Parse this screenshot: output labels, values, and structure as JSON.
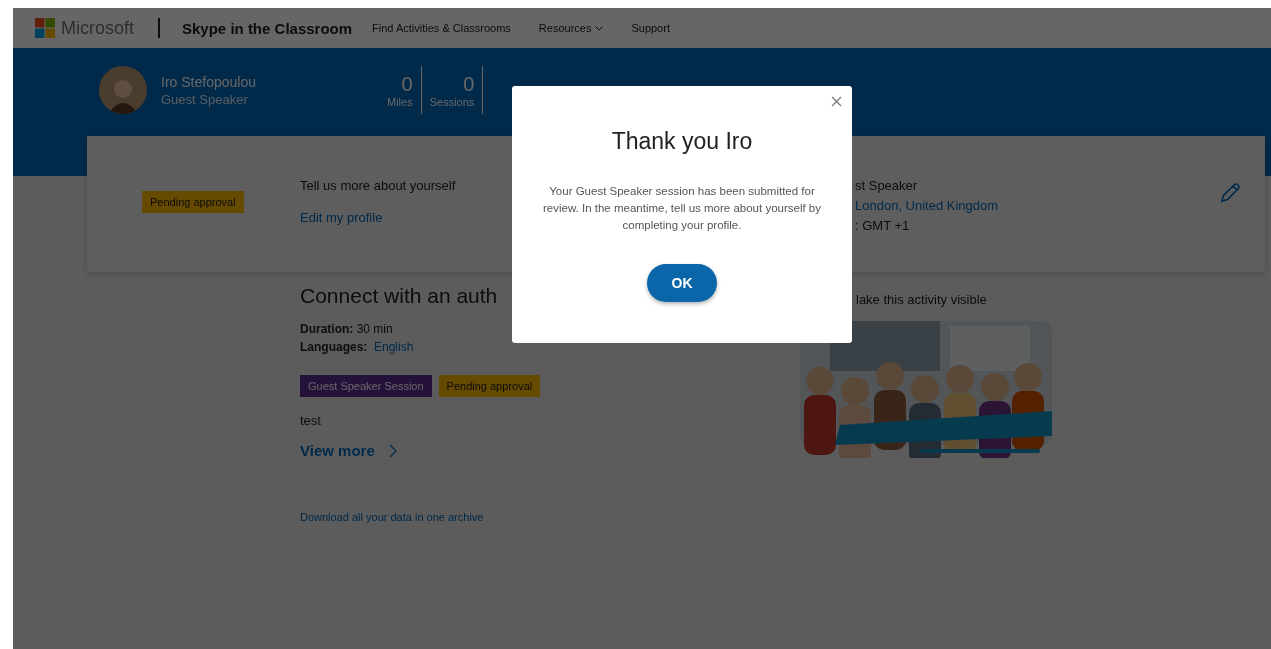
{
  "nav": {
    "brand": "Microsoft",
    "product": "Skype in the Classroom",
    "links": [
      {
        "label": "Find Activities & Classrooms",
        "dropdown": false
      },
      {
        "label": "Resources",
        "dropdown": true
      },
      {
        "label": "Support",
        "dropdown": false
      }
    ]
  },
  "profile": {
    "name": "Iro Stefopoulou",
    "role": "Guest Speaker",
    "stats": [
      {
        "value": "0",
        "label": "Miles"
      },
      {
        "value": "0",
        "label": "Sessions"
      }
    ]
  },
  "card": {
    "status": "Pending approval",
    "prompt": "Tell us more about yourself",
    "edit_link": "Edit my profile",
    "details": [
      {
        "kind": "plain",
        "text": "st Speaker"
      },
      {
        "kind": "link",
        "text": "London, United Kingdom"
      },
      {
        "kind": "plain",
        "text": ": GMT +1"
      }
    ]
  },
  "activity": {
    "title": "Connect with an auth",
    "duration_label": "Duration:",
    "duration": "30 min",
    "languages_label": "Languages:",
    "language": "English",
    "tags": [
      {
        "label": "Guest Speaker Session",
        "kind": "type"
      },
      {
        "label": "Pending approval",
        "kind": "status"
      }
    ],
    "description": "test",
    "view_more": "View more",
    "download": "Download all your data in one archive",
    "visibility": "lake this activity visible"
  },
  "dialog": {
    "title": "Thank you Iro",
    "message": "Your Guest Speaker session has been submitted for review. In the meantime, tell us more about yourself by completing your profile.",
    "button": "OK"
  }
}
